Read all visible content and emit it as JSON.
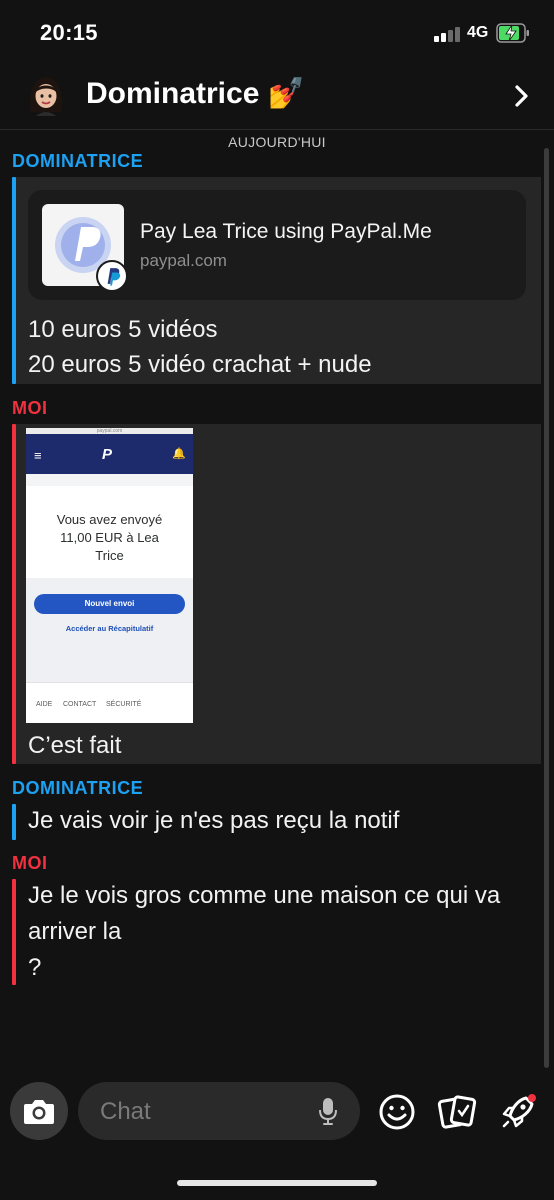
{
  "status_bar": {
    "time": "20:15",
    "network": "4G"
  },
  "header": {
    "contact_name": "Dominatrice 💅"
  },
  "day_label": "AUJOURD'HUI",
  "messages": [
    {
      "sender": "DOMINATRICE",
      "link_preview": {
        "title": "Pay Lea Trice using PayPal.Me",
        "domain": "paypal.com"
      },
      "lines": [
        "10 euros 5 vidéos",
        "20 euros 5 vidéo crachat + nude"
      ]
    },
    {
      "sender": "MOI",
      "screenshot": {
        "url": "paypal.com",
        "text_lines": [
          "Vous avez envoyé",
          "11,00 EUR à Lea",
          "Trice"
        ],
        "primary_button": "Nouvel envoi",
        "link": "Accéder au Récapitulatif",
        "footer_links": [
          "AIDE",
          "CONTACT",
          "SÉCURITÉ"
        ]
      },
      "lines": [
        "C’est fait"
      ]
    },
    {
      "sender": "DOMINATRICE",
      "lines": [
        "Je vais voir je n'es pas reçu la notif"
      ]
    },
    {
      "sender": "MOI",
      "lines": [
        "Je le vois gros comme une maison ce qui va",
        "arriver la",
        "?"
      ]
    }
  ],
  "composer": {
    "placeholder": "Chat"
  },
  "colors": {
    "friend_accent": "#1da1f2",
    "me_accent": "#f0313f",
    "background": "#121212"
  }
}
